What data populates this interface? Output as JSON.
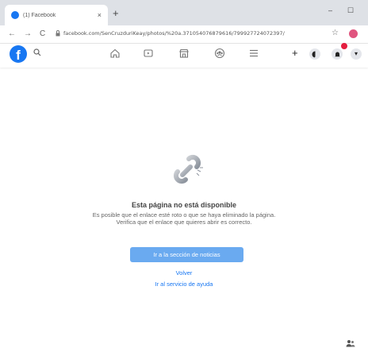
{
  "browser": {
    "tab_title": "(1) Facebook",
    "tab_close": "×",
    "new_tab": "+",
    "minimize": "–",
    "maximize": "☐",
    "back": "←",
    "forward": "→",
    "reload": "C",
    "url": "facebook.com/SenCruzduriKeay/photos/%20a.371054076879616/799927724072397/",
    "star": "☆"
  },
  "fb_header": {
    "logo": "f",
    "search_icon": "search-icon",
    "nav_icons": [
      "home-icon",
      "watch-icon",
      "marketplace-icon",
      "groups-icon",
      "menu-icon"
    ],
    "right_icons": [
      "plus-icon",
      "messenger-icon",
      "notifications-icon",
      "account-menu-icon"
    ]
  },
  "error": {
    "heading": "Esta página no está disponible",
    "description": "Es posible que el enlace esté roto o que se haya eliminado la página. Verifica que el enlace que quieres abrir es correcto.",
    "news_button": "Ir a la sección de noticias",
    "back_link": "Volver",
    "help_link": "Ir al servicio de ayuda"
  },
  "colors": {
    "facebook_blue": "#1877f2",
    "button_blue": "#6aaaf0",
    "badge_red": "#e41e3f"
  }
}
